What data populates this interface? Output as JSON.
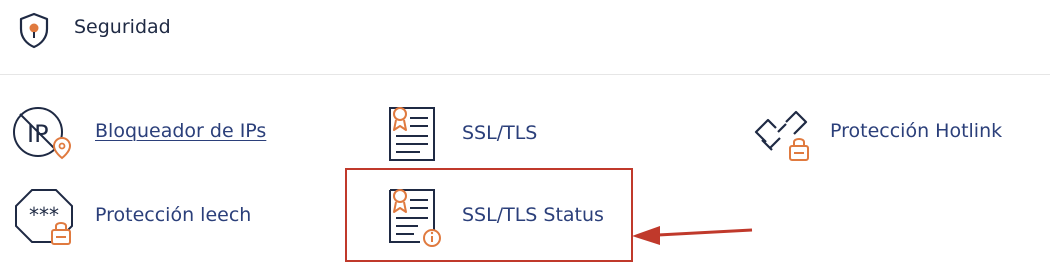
{
  "section": {
    "title": "Seguridad",
    "icon": "shield-icon"
  },
  "items": [
    {
      "label": "Bloqueador de IPs",
      "icon": "ip-blocker-icon"
    },
    {
      "label": "SSL/TLS",
      "icon": "certificate-document-icon"
    },
    {
      "label": "Protección Hotlink",
      "icon": "broken-link-lock-icon"
    },
    {
      "label": "Protección leech",
      "icon": "octagon-lock-icon"
    },
    {
      "label": "SSL/TLS Status",
      "icon": "certificate-status-icon"
    }
  ],
  "colors": {
    "accent": "#e07a3f",
    "link": "#2b3f7a",
    "icon_dark": "#1f2a44",
    "highlight": "#c0392b"
  }
}
